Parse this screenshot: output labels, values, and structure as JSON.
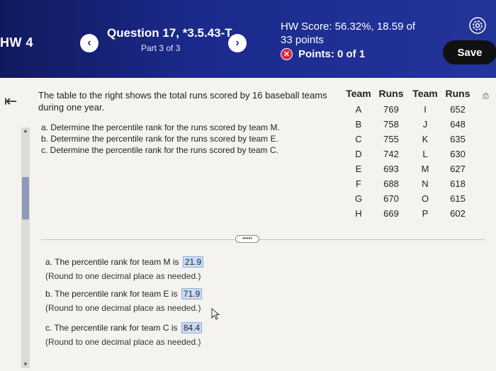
{
  "header": {
    "hw_label": "HW 4",
    "question_title": "Question 17, *3.5.43-T",
    "part_label": "Part 3 of 3",
    "score_line1": "HW Score: 56.32%, 18.59 of",
    "score_line2": "33 points",
    "points_text": "Points: 0 of 1",
    "save_label": "Save",
    "prev_glyph": "‹",
    "next_glyph": "›"
  },
  "question": {
    "prompt": "The table to the right shows the total runs scored by 16 baseball teams during one year.",
    "sub_a": "a. Determine the percentile rank for the runs scored by team M.",
    "sub_b": "b. Determine the percentile rank for the runs scored by team E.",
    "sub_c": "c. Determine the percentile rank for the runs scored by team C."
  },
  "table": {
    "headers": [
      "Team",
      "Runs",
      "Team",
      "Runs"
    ],
    "rows": [
      [
        "A",
        "769",
        "I",
        "652"
      ],
      [
        "B",
        "758",
        "J",
        "648"
      ],
      [
        "C",
        "755",
        "K",
        "635"
      ],
      [
        "D",
        "742",
        "L",
        "630"
      ],
      [
        "E",
        "693",
        "M",
        "627"
      ],
      [
        "F",
        "688",
        "N",
        "618"
      ],
      [
        "G",
        "670",
        "O",
        "615"
      ],
      [
        "H",
        "669",
        "P",
        "602"
      ]
    ]
  },
  "more_label": "•••••",
  "answers": {
    "a_text": "a. The percentile rank for team M is",
    "a_value": "21.9",
    "b_text": "b. The percentile rank for team E is",
    "b_value": "71.9",
    "c_text": "c. The percentile rank for team C is",
    "c_value": "84.4",
    "hint": "(Round to one decimal place as needed.)"
  },
  "colors": {
    "header_bg": "#1b2a8c",
    "save_bg": "#111111",
    "error_red": "#d8273b",
    "answer_box": "#c9dcf3"
  },
  "icons": [
    "gear-icon",
    "x-circle-icon",
    "collapse-icon",
    "print-icon",
    "cursor-icon"
  ]
}
